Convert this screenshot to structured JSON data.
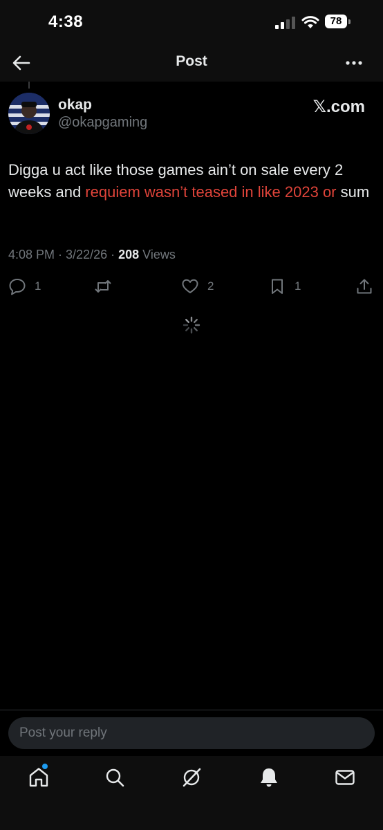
{
  "status_bar": {
    "time": "4:38",
    "battery_level": "78"
  },
  "header": {
    "title": "Post"
  },
  "post": {
    "author_name": "okap",
    "author_handle": "@okapgaming",
    "source_brand": "𝕏.com",
    "text_part1": "Digga u act like those games ain’t on sale every 2 weeks and ",
    "text_highlight": "requiem wasn’t teased in like 2023 or",
    "text_part2": " sum",
    "time": "4:08 PM",
    "date": "3/22/26",
    "views_count": "208",
    "views_label": " Views",
    "separator": " · "
  },
  "actions": {
    "reply_count": "1",
    "repost_count": "",
    "like_count": "2",
    "bookmark_count": "1"
  },
  "reply_box": {
    "placeholder": "Post your reply"
  },
  "colors": {
    "background": "#000000",
    "text": "#e7e9ea",
    "muted": "#71767b",
    "highlight": "#e0443a",
    "accent": "#1d9bf0"
  },
  "icons": {
    "back": "arrow-left-icon",
    "more": "ellipsis-icon",
    "reply": "speech-bubble-icon",
    "repost": "repost-arrows-icon",
    "like": "heart-icon",
    "bookmark": "bookmark-icon",
    "share": "share-upload-icon",
    "spinner": "loading-spinner-icon",
    "home": "home-icon",
    "search": "search-icon",
    "grok": "grok-icon",
    "notifications": "bell-icon",
    "messages": "envelope-icon"
  }
}
